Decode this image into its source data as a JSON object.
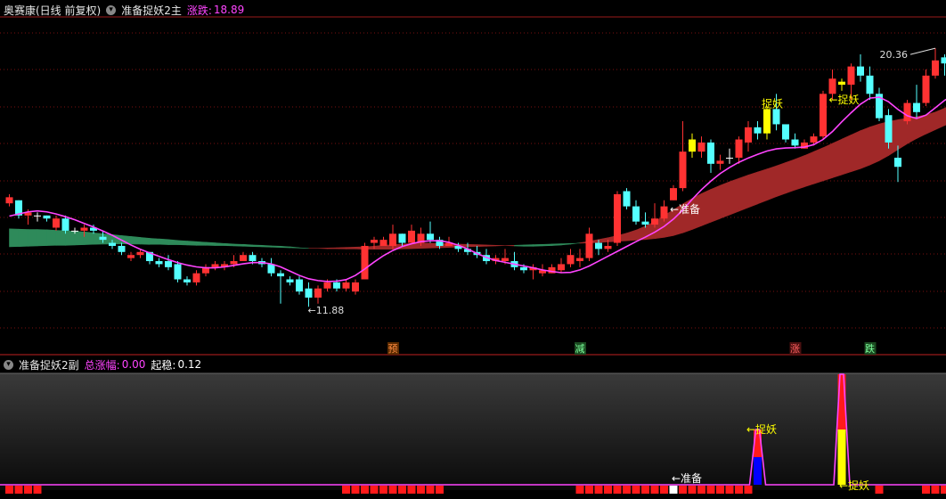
{
  "main_header": {
    "stock_name": "奥赛康(日线 前复权)",
    "indicator_name": "准备捉妖2主",
    "change_label": "涨跌:",
    "change_value": "18.89"
  },
  "sub_header": {
    "indicator_name": "准备捉妖2副",
    "total_label": "总涨幅:",
    "total_value": "0.00",
    "start_label": "起稳:",
    "start_value": "0.12"
  },
  "colors": {
    "up": "#ff3232",
    "down": "#54ffff",
    "flat": "#ffffff",
    "highlight": "#ffff00",
    "ma_line": "#ff44ff",
    "band_up": "#a02828",
    "band_down": "#2e8a5a",
    "grid": "#7a1010",
    "panel_bg_top": "#3a3a3a",
    "panel_bg_bottom": "#0a0a0a"
  },
  "chart_data": [
    {
      "type": "candlestick",
      "title": "准备捉妖2主",
      "ylim": [
        10.5,
        21.4
      ],
      "max_label": "20.36",
      "min_label": "←11.88",
      "candles": [
        [
          15.3,
          15.6,
          15.2,
          15.5
        ],
        [
          15.4,
          15.4,
          14.8,
          14.9
        ],
        [
          14.9,
          15.1,
          14.6,
          15.0
        ],
        [
          14.9,
          15.0,
          14.7,
          14.9
        ],
        [
          14.9,
          14.9,
          14.7,
          14.8
        ],
        [
          14.5,
          14.9,
          14.4,
          14.8
        ],
        [
          14.8,
          14.9,
          14.3,
          14.4
        ],
        [
          14.4,
          14.5,
          14.3,
          14.4
        ],
        [
          14.4,
          14.6,
          14.2,
          14.5
        ],
        [
          14.5,
          14.6,
          14.3,
          14.4
        ],
        [
          14.2,
          14.4,
          14.0,
          14.1
        ],
        [
          14.0,
          14.1,
          13.8,
          13.9
        ],
        [
          13.9,
          14.0,
          13.6,
          13.7
        ],
        [
          13.5,
          13.7,
          13.4,
          13.6
        ],
        [
          13.6,
          13.8,
          13.5,
          13.7
        ],
        [
          13.7,
          13.7,
          13.3,
          13.4
        ],
        [
          13.4,
          13.5,
          13.2,
          13.3
        ],
        [
          13.4,
          13.6,
          13.1,
          13.2
        ],
        [
          13.3,
          13.4,
          12.7,
          12.8
        ],
        [
          12.8,
          12.9,
          12.6,
          12.7
        ],
        [
          12.7,
          13.1,
          12.6,
          13.0
        ],
        [
          13.0,
          13.3,
          12.9,
          13.2
        ],
        [
          13.2,
          13.4,
          13.1,
          13.3
        ],
        [
          13.2,
          13.4,
          13.1,
          13.3
        ],
        [
          13.3,
          13.6,
          13.2,
          13.4
        ],
        [
          13.4,
          13.7,
          13.4,
          13.6
        ],
        [
          13.6,
          13.7,
          13.3,
          13.4
        ],
        [
          13.4,
          13.5,
          13.2,
          13.3
        ],
        [
          13.3,
          13.5,
          12.9,
          13.0
        ],
        [
          13.0,
          13.1,
          12.0,
          12.9
        ],
        [
          12.8,
          12.9,
          12.6,
          12.7
        ],
        [
          12.8,
          12.9,
          12.3,
          12.4
        ],
        [
          12.5,
          12.7,
          11.9,
          12.2
        ],
        [
          12.2,
          12.6,
          12.0,
          12.5
        ],
        [
          12.5,
          12.8,
          12.4,
          12.7
        ],
        [
          12.7,
          12.8,
          12.4,
          12.5
        ],
        [
          12.5,
          12.8,
          12.4,
          12.7
        ],
        [
          12.4,
          12.8,
          12.3,
          12.7
        ],
        [
          12.8,
          14.0,
          12.8,
          13.9
        ],
        [
          14.0,
          14.2,
          13.8,
          14.1
        ],
        [
          13.9,
          14.2,
          13.9,
          14.1
        ],
        [
          13.9,
          14.6,
          13.8,
          14.3
        ],
        [
          14.3,
          14.3,
          13.9,
          14.0
        ],
        [
          14.0,
          14.6,
          14.0,
          14.4
        ],
        [
          14.0,
          14.5,
          13.9,
          14.3
        ],
        [
          14.3,
          14.7,
          14.0,
          14.1
        ],
        [
          14.1,
          14.2,
          13.8,
          13.9
        ],
        [
          13.9,
          14.2,
          13.9,
          14.0
        ],
        [
          13.9,
          14.0,
          13.7,
          13.8
        ],
        [
          13.8,
          14.0,
          13.6,
          13.7
        ],
        [
          13.7,
          13.9,
          13.5,
          13.6
        ],
        [
          13.6,
          13.8,
          13.3,
          13.4
        ],
        [
          13.4,
          13.6,
          13.3,
          13.5
        ],
        [
          13.4,
          13.8,
          13.3,
          13.5
        ],
        [
          13.4,
          13.7,
          13.1,
          13.2
        ],
        [
          13.2,
          13.3,
          13.0,
          13.1
        ],
        [
          13.1,
          13.3,
          12.8,
          13.2
        ],
        [
          13.0,
          13.3,
          12.9,
          13.1
        ],
        [
          13.0,
          13.3,
          13.0,
          13.2
        ],
        [
          13.1,
          13.5,
          13.0,
          13.3
        ],
        [
          13.3,
          13.8,
          13.2,
          13.6
        ],
        [
          13.4,
          13.8,
          13.2,
          13.5
        ],
        [
          13.5,
          14.5,
          13.4,
          14.3
        ],
        [
          14.0,
          14.1,
          13.6,
          13.8
        ],
        [
          13.8,
          14.1,
          13.7,
          13.9
        ],
        [
          14.0,
          15.7,
          13.9,
          15.6
        ],
        [
          15.7,
          15.8,
          15.1,
          15.2
        ],
        [
          15.2,
          15.4,
          14.6,
          14.7
        ],
        [
          14.7,
          15.0,
          14.5,
          14.6
        ],
        [
          14.6,
          15.3,
          14.5,
          14.8
        ],
        [
          14.8,
          15.4,
          14.7,
          15.2
        ],
        [
          15.4,
          15.9,
          15.4,
          15.8
        ],
        [
          15.8,
          18.0,
          15.7,
          17.0
        ],
        [
          17.0,
          17.6,
          16.8,
          17.4
        ],
        [
          17.0,
          17.5,
          16.8,
          17.3
        ],
        [
          17.3,
          17.4,
          16.3,
          16.6
        ],
        [
          16.6,
          16.9,
          16.4,
          16.7
        ],
        [
          16.8,
          17.1,
          16.6,
          16.8
        ],
        [
          16.8,
          17.5,
          16.6,
          17.4
        ],
        [
          17.3,
          18.0,
          17.0,
          17.8
        ],
        [
          17.8,
          18.0,
          17.4,
          17.6
        ],
        [
          17.6,
          18.5,
          17.4,
          18.4
        ],
        [
          18.4,
          18.9,
          17.7,
          17.9
        ],
        [
          17.9,
          17.9,
          17.3,
          17.4
        ],
        [
          17.4,
          17.6,
          17.1,
          17.2
        ],
        [
          17.1,
          17.4,
          17.1,
          17.3
        ],
        [
          17.3,
          17.6,
          17.2,
          17.5
        ],
        [
          17.5,
          19.0,
          17.4,
          18.9
        ],
        [
          18.9,
          19.7,
          18.7,
          19.4
        ],
        [
          19.3,
          19.4,
          19.0,
          19.2
        ],
        [
          19.2,
          19.9,
          18.7,
          19.8
        ],
        [
          19.8,
          20.2,
          19.3,
          19.5
        ],
        [
          19.5,
          19.8,
          18.7,
          18.9
        ],
        [
          18.9,
          19.1,
          18.0,
          18.1
        ],
        [
          18.2,
          18.4,
          17.1,
          17.3
        ],
        [
          16.8,
          17.2,
          16.0,
          16.5
        ],
        [
          18.0,
          18.7,
          17.9,
          18.6
        ],
        [
          18.6,
          19.2,
          18.1,
          18.3
        ],
        [
          18.6,
          19.7,
          18.5,
          19.5
        ],
        [
          19.5,
          20.4,
          19.4,
          20.0
        ],
        [
          20.1,
          20.2,
          19.5,
          19.9
        ],
        [
          19.8,
          19.9,
          19.7,
          19.7
        ]
      ],
      "highlight_candles": [
        73,
        81,
        89
      ],
      "ma_line": [
        14.88,
        14.95,
        15.02,
        15.05,
        15.02,
        14.95,
        14.86,
        14.76,
        14.64,
        14.52,
        14.39,
        14.25,
        14.09,
        13.93,
        13.79,
        13.67,
        13.56,
        13.45,
        13.35,
        13.27,
        13.21,
        13.18,
        13.18,
        13.21,
        13.26,
        13.31,
        13.35,
        13.35,
        13.31,
        13.21,
        13.07,
        12.93,
        12.82,
        12.76,
        12.73,
        12.74,
        12.79,
        12.93,
        13.14,
        13.37,
        13.58,
        13.75,
        13.88,
        13.97,
        14.04,
        14.07,
        14.07,
        14.02,
        13.92,
        13.8,
        13.65,
        13.52,
        13.42,
        13.36,
        13.3,
        13.24,
        13.18,
        13.11,
        13.06,
        13.02,
        13.03,
        13.11,
        13.24,
        13.4,
        13.56,
        13.72,
        13.88,
        14.04,
        14.19,
        14.35,
        14.54,
        14.78,
        15.08,
        15.43,
        15.75,
        16.03,
        16.28,
        16.48,
        16.65,
        16.79,
        16.91,
        17.02,
        17.09,
        17.12,
        17.13,
        17.15,
        17.23,
        17.4,
        17.66,
        17.98,
        18.28,
        18.56,
        18.76,
        18.79,
        18.64,
        18.39,
        18.18,
        18.09,
        18.2,
        18.44,
        18.69,
        18.85
      ],
      "band_upper": [
        13.87,
        13.88,
        13.89,
        13.9,
        13.91,
        13.92,
        13.92,
        13.93,
        13.94,
        13.95,
        13.96,
        13.96,
        13.97,
        13.96,
        13.96,
        13.95,
        13.95,
        13.94,
        13.94,
        13.93,
        13.92,
        13.92,
        13.91,
        13.91,
        13.9,
        13.89,
        13.88,
        13.87,
        13.86,
        13.85,
        13.84,
        13.83,
        13.82,
        13.82,
        13.83,
        13.84,
        13.85,
        13.86,
        13.87,
        13.89,
        13.92,
        13.94,
        13.96,
        13.98,
        14.0,
        13.99,
        13.98,
        13.97,
        13.96,
        13.95,
        13.94,
        13.93,
        13.92,
        13.91,
        13.9,
        13.89,
        13.89,
        13.9,
        13.91,
        13.93,
        13.96,
        14.0,
        14.05,
        14.11,
        14.17,
        14.24,
        14.32,
        14.42,
        14.55,
        14.7,
        14.89,
        15.09,
        15.28,
        15.46,
        15.62,
        15.76,
        15.89,
        16.01,
        16.12,
        16.23,
        16.33,
        16.43,
        16.53,
        16.64,
        16.75,
        16.87,
        17.0,
        17.13,
        17.27,
        17.41,
        17.55,
        17.69,
        17.81,
        17.91,
        17.99,
        18.05,
        18.1,
        18.15,
        18.21,
        18.3,
        18.43,
        18.6
      ],
      "band_lower": [
        14.46,
        14.45,
        14.44,
        14.44,
        14.43,
        14.41,
        14.4,
        14.38,
        14.36,
        14.33,
        14.3,
        14.27,
        14.24,
        14.21,
        14.18,
        14.15,
        14.13,
        14.11,
        14.08,
        14.06,
        14.04,
        14.02,
        14.0,
        13.98,
        13.96,
        13.95,
        13.93,
        13.92,
        13.9,
        13.89,
        13.87,
        13.84,
        13.82,
        13.82,
        13.81,
        13.81,
        13.8,
        13.8,
        13.79,
        13.79,
        13.79,
        13.79,
        13.8,
        13.81,
        13.82,
        13.83,
        13.84,
        13.85,
        13.86,
        13.87,
        13.88,
        13.89,
        13.9,
        13.91,
        13.92,
        13.93,
        13.94,
        13.95,
        13.96,
        13.97,
        13.98,
        13.99,
        14.0,
        14.01,
        14.03,
        14.05,
        14.07,
        14.09,
        14.11,
        14.14,
        14.18,
        14.24,
        14.33,
        14.44,
        14.56,
        14.68,
        14.8,
        14.92,
        15.04,
        15.16,
        15.28,
        15.4,
        15.52,
        15.63,
        15.74,
        15.84,
        15.94,
        16.04,
        16.14,
        16.24,
        16.34,
        16.44,
        16.56,
        16.7,
        16.87,
        17.07,
        17.26,
        17.43,
        17.58,
        17.72,
        17.86,
        18.0
      ],
      "annotations": [
        {
          "index": 71,
          "text": "←准备",
          "color": "#ffffff"
        },
        {
          "index": 81,
          "text": "捉妖",
          "color": "#ffff00"
        },
        {
          "index": 88,
          "text": "←捉妖",
          "color": "#ffff00"
        }
      ],
      "bottom_labels": [
        {
          "index": 41,
          "text": "预",
          "color": "#ff8c42",
          "bg": "#5a2a00"
        },
        {
          "index": 61,
          "text": "减",
          "color": "#7dff9d",
          "bg": "#1a4a20"
        },
        {
          "index": 84,
          "text": "涨",
          "color": "#ff6060",
          "bg": "#4a1010"
        },
        {
          "index": 92,
          "text": "跌",
          "color": "#7dff9d",
          "bg": "#1a4a20"
        }
      ]
    },
    {
      "type": "bar",
      "title": "准备捉妖2副",
      "ylim": [
        0,
        1
      ],
      "red_blocks": [
        {
          "from": 0,
          "to": 3
        },
        {
          "from": 36,
          "to": 46
        },
        {
          "from": 61,
          "to": 79
        },
        {
          "from": 93,
          "to": 93
        },
        {
          "from": 98,
          "to": 101
        }
      ],
      "white_blocks": [
        71
      ],
      "spikes": [
        {
          "index": 80,
          "height": 0.5,
          "color": "#0000ff"
        },
        {
          "index": 89,
          "height": 1.0,
          "color": "#ffff00"
        }
      ],
      "annotations": [
        {
          "index": 71,
          "text": "←准备",
          "color": "#ffffff"
        },
        {
          "index": 79,
          "text": "←捉妖",
          "color": "#ffff00"
        },
        {
          "index": 89,
          "text": "←捉妖",
          "color": "#ffff00"
        }
      ]
    }
  ]
}
